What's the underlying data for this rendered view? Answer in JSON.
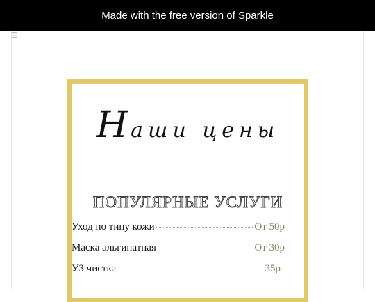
{
  "banner": {
    "text": "Made with the free version of Sparkle"
  },
  "menu": {
    "title_first": "Н",
    "title_rest": "аши цены",
    "section": "ПОПУЛЯРНЫЕ УСЛУГИ",
    "items": [
      {
        "name": "Уход по типу кожи",
        "price": "От 50р"
      },
      {
        "name": "Маска альгинатная",
        "price": "От 30р"
      },
      {
        "name": "УЗ чистка",
        "price": "35р"
      }
    ]
  },
  "colors": {
    "frame": "#e0c96a",
    "banner_bg": "#000000",
    "price": "#8f8068"
  }
}
